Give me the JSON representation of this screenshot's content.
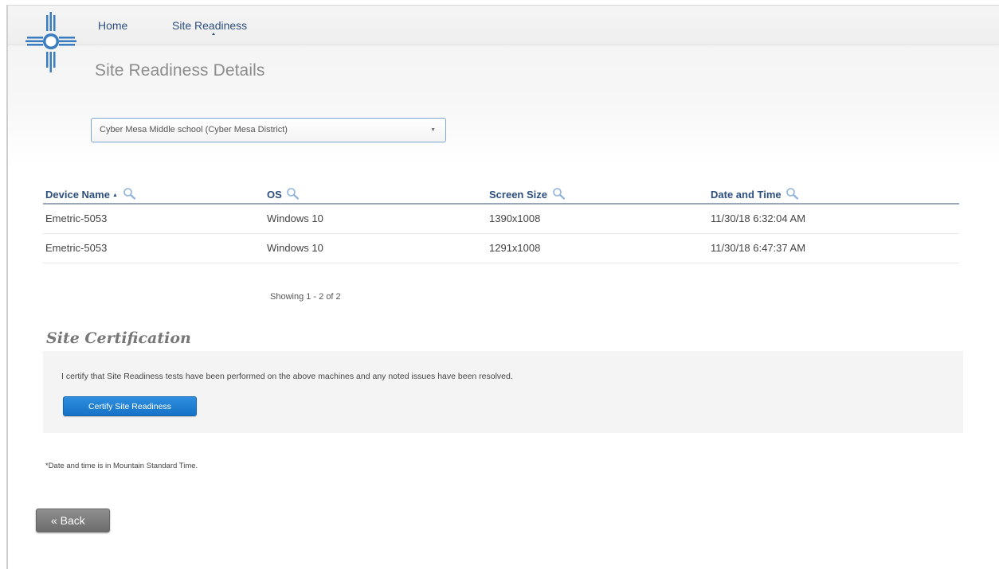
{
  "nav": {
    "home": "Home",
    "site_readiness": "Site Readiness"
  },
  "page_title": "Site Readiness Details",
  "school_select": {
    "selected": "Cyber Mesa Middle school (Cyber Mesa District)"
  },
  "table": {
    "headers": [
      "Device Name",
      "OS",
      "Screen Size",
      "Date and Time"
    ],
    "sort_indicator": "▲",
    "rows": [
      [
        "Emetric-5053",
        "Windows 10",
        "1390x1008",
        "11/30/18 6:32:04 AM"
      ],
      [
        "Emetric-5053",
        "Windows 10",
        "1291x1008",
        "11/30/18 6:47:37 AM"
      ]
    ]
  },
  "paging": "Showing 1 - 2 of 2",
  "certification": {
    "heading": "Site Certification",
    "statement": "I certify that Site Readiness tests have been performed on the above machines and any noted issues have been resolved.",
    "button": "Certify Site Readiness"
  },
  "footnote": "*Date and time is in Mountain Standard Time.",
  "back_button": "« Back",
  "icons": {
    "logo": "zia-sun-logo",
    "search": "magnifier-icon"
  },
  "colors": {
    "link": "#2c4f7f",
    "primary_button": "#1b7bd2",
    "back_button": "#7a7a7a",
    "logo": "#3a7cc0"
  }
}
